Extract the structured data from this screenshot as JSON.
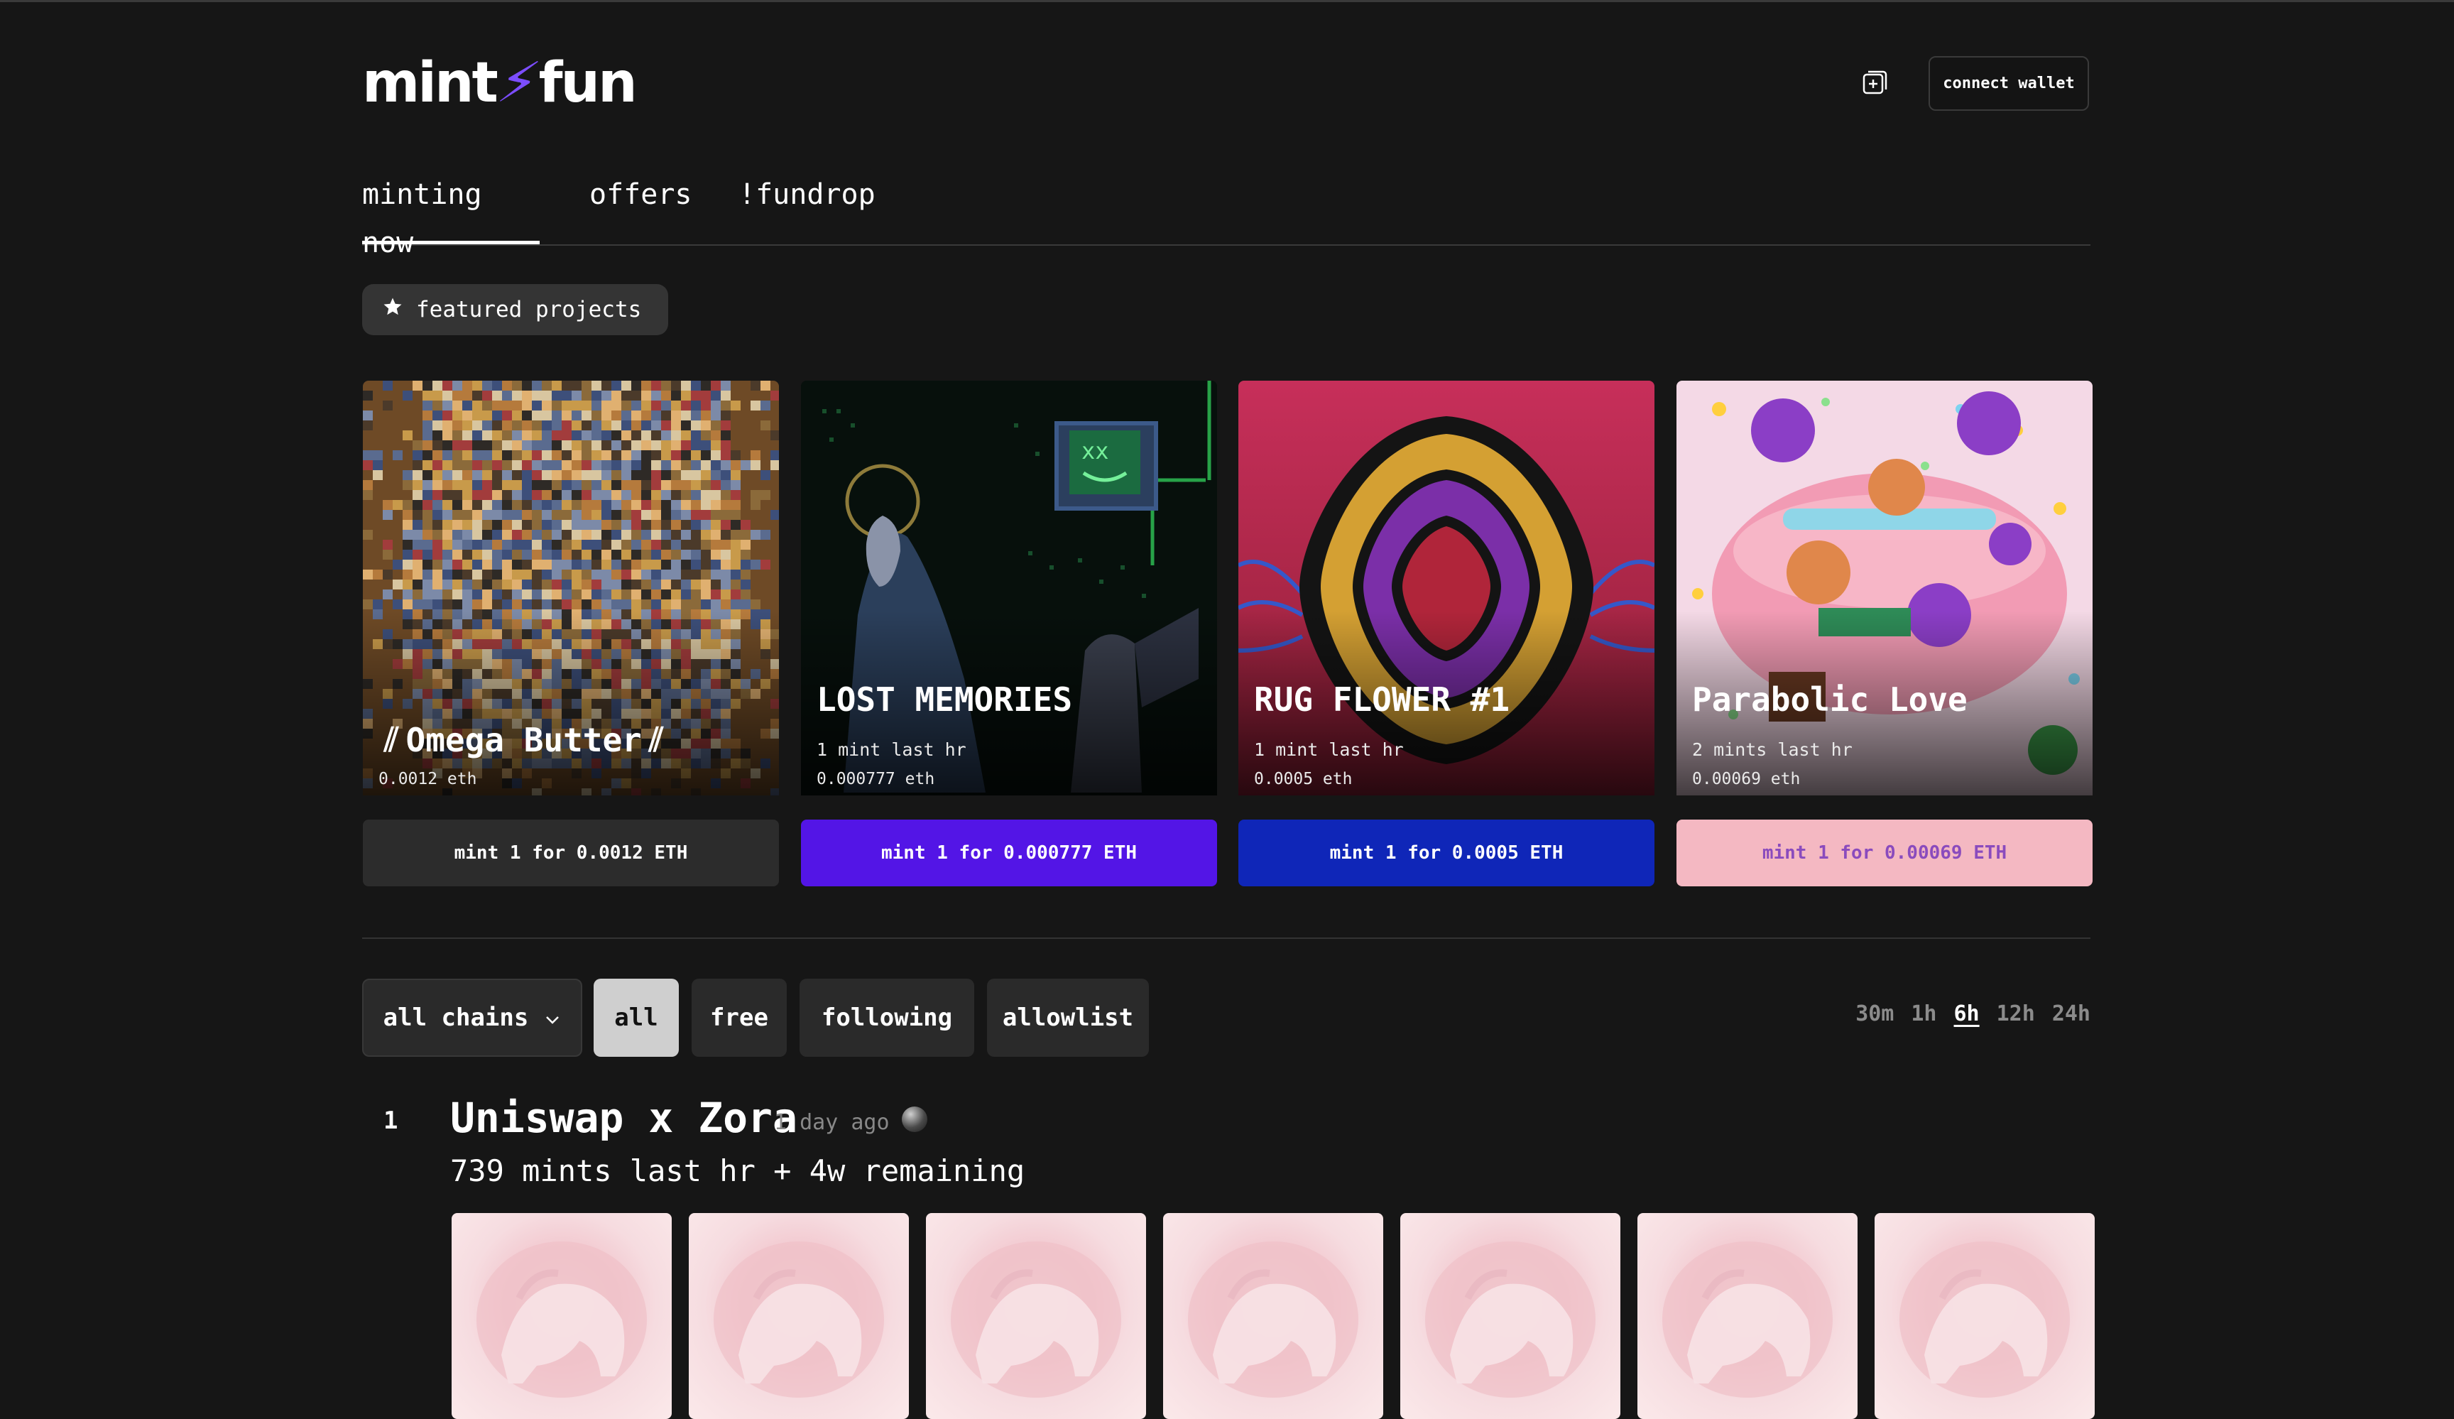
{
  "header": {
    "logo_left": "mint",
    "logo_bolt": "⚡",
    "logo_right": "fun",
    "add_icon": "square-plus-icon",
    "connect_label": "connect wallet"
  },
  "tabs": [
    {
      "label": "minting now",
      "active": true
    },
    {
      "label": "offers",
      "active": false
    },
    {
      "label": "!fundrop",
      "active": false
    }
  ],
  "featured": {
    "icon": "star-icon",
    "label": "featured projects"
  },
  "cards": [
    {
      "title": "Omega Butter",
      "meta": "",
      "price": "0.0012 eth",
      "button": "mint 1 for 0.0012 ETH",
      "button_color": "#2c2c2c"
    },
    {
      "title": "LOST MEMORIES",
      "meta": "1 mint last hr",
      "price": "0.000777 eth",
      "button": "mint 1 for 0.000777 ETH",
      "button_color": "#5315e6"
    },
    {
      "title": "RUG FLOWER #1",
      "meta": "1 mint last hr",
      "price": "0.0005 eth",
      "button": "mint 1 for 0.0005 ETH",
      "button_color": "#0f26b8"
    },
    {
      "title": "Parabolic Love",
      "meta": "2 mints last hr",
      "price": "0.00069 eth",
      "button": "mint 1 for 0.00069 ETH",
      "button_color": "#f4b8c2"
    }
  ],
  "filters": {
    "chain_select": "all chains",
    "buttons": [
      {
        "label": "all",
        "active": true
      },
      {
        "label": "free",
        "active": false
      },
      {
        "label": "following",
        "active": false
      },
      {
        "label": "allowlist",
        "active": false
      }
    ],
    "time_ranges": [
      {
        "label": "30m",
        "active": false
      },
      {
        "label": "1h",
        "active": false
      },
      {
        "label": "6h",
        "active": true
      },
      {
        "label": "12h",
        "active": false
      },
      {
        "label": "24h",
        "active": false
      }
    ]
  },
  "listing": {
    "rank": "1",
    "title": "Uniswap x Zora",
    "age": "1 day ago",
    "subtitle": "739 mints last hr + 4w remaining",
    "thumb_count": 7
  },
  "colors": {
    "background": "#161616",
    "accent": "#7c4dff"
  }
}
